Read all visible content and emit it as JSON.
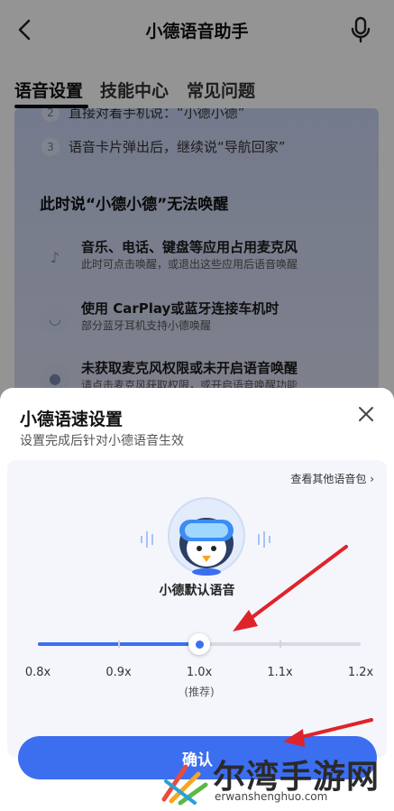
{
  "nav": {
    "title": "小德语音助手"
  },
  "tabs": [
    {
      "label": "语音设置"
    },
    {
      "label": "技能中心"
    },
    {
      "label": "常见问题"
    }
  ],
  "background": {
    "steps": [
      {
        "num": "2",
        "text": "直接对着手机说：“小德小德”"
      },
      {
        "num": "3",
        "text": "语音卡片弹出后，继续说“导航回家”"
      }
    ],
    "section_title": "此时说“小德小德”无法唤醒",
    "features": [
      {
        "icon": "music-icon",
        "title": "音乐、电话、键盘等应用占用麦克风",
        "sub": "此时可点击唤醒，或退出这些应用后语音唤醒"
      },
      {
        "icon": "earbuds-icon",
        "title": "使用 CarPlay或蓝牙连接车机时",
        "sub": "部分蓝牙耳机支持小德唤醒"
      },
      {
        "icon": "microphone-icon",
        "title": "未获取麦克风权限或未开启语音唤醒",
        "sub": "请点击麦克风获取权限，或开启语音唤醒功能"
      }
    ]
  },
  "sheet": {
    "title": "小德语速设置",
    "subtitle": "设置完成后针对小德语音生效",
    "more_link": "查看其他语音包 ›",
    "voice_name": "小德默认语音",
    "speeds": [
      "0.8x",
      "0.9x",
      "1.0x",
      "1.1x",
      "1.2x"
    ],
    "selected_speed": "1.0x",
    "recommended_note": "(推荐)",
    "confirm_label": "确认"
  },
  "colors": {
    "accent": "#3c6ef0",
    "arrow": "#e0232a"
  },
  "watermark": {
    "text": "尔湾手游网",
    "url": "erwanshenghuo.com"
  }
}
